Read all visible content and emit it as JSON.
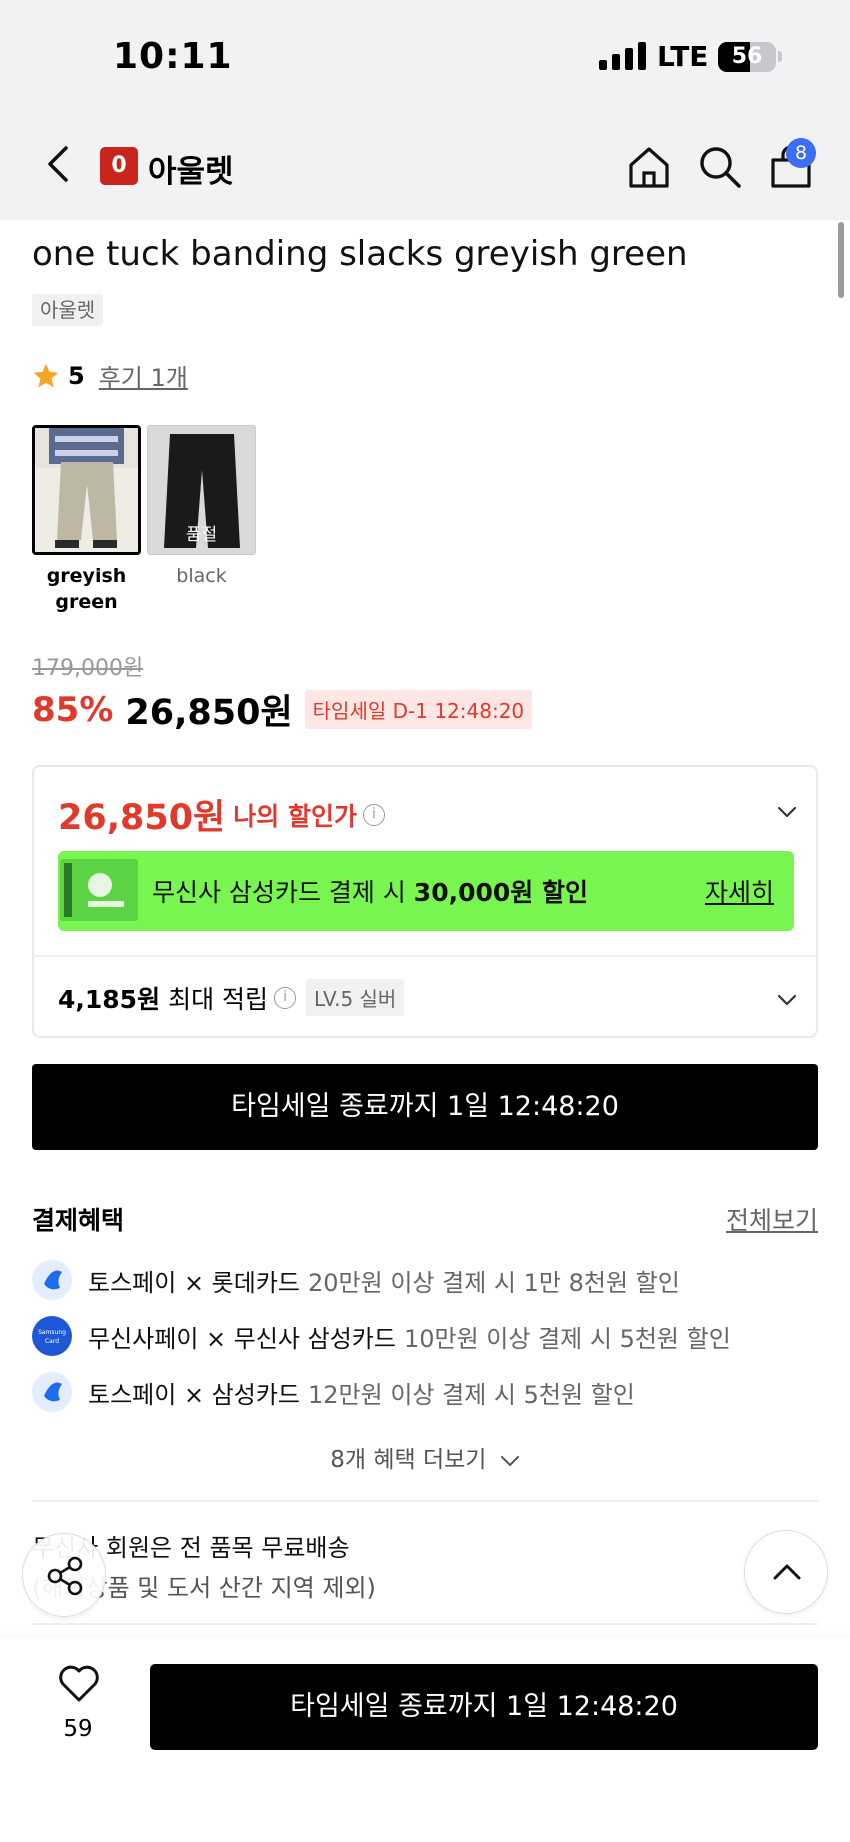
{
  "status_bar": {
    "time": "10:11",
    "network": "LTE",
    "battery": "56",
    "battery_fraction": 0.56
  },
  "nav": {
    "brand_logo": "0",
    "brand_name": "아울렛",
    "cart_count": "8"
  },
  "product": {
    "title": "one tuck banding slacks greyish green",
    "brand_chip": "아울렛",
    "rating": "5",
    "reviews": "후기 1개",
    "options": [
      {
        "label": "greyish\ngreen",
        "selected": true
      },
      {
        "label": "black",
        "selected": false,
        "sold_out": "품절"
      }
    ],
    "original_price": "179,000원",
    "discount": "85%",
    "sale_price": "26,850원",
    "timesale_badge": "타임세일 D-1 12:48:20"
  },
  "benefit_box": {
    "my_price": "26,850원",
    "my_price_label": "나의 할인가",
    "card_text_prefix": "무신사 삼성카드 결제 시 ",
    "card_text_amount": "30,000원 할인",
    "card_more": "자세히",
    "points": "4,185원",
    "points_label": "최대 적립",
    "level": "LV.5 실버"
  },
  "timesale_button": "타임세일 종료까지 1일 12:48:20",
  "payment_benefits": {
    "title": "결제혜택",
    "view_all": "전체보기",
    "items": [
      {
        "name": "토스페이 × 롯데카드",
        "desc": "20만원 이상 결제 시 1만 8천원 할인",
        "icon": "toss-icon"
      },
      {
        "name": "무신사페이 × 무신사 삼성카드",
        "desc": "10만원 이상 결제 시 5천원 할인",
        "icon": "samsung-card-icon",
        "icon_text": "Samsung Card"
      },
      {
        "name": "토스페이 × 삼성카드",
        "desc": "12만원 이상 결제 시 5천원 할인",
        "icon": "toss-icon"
      }
    ],
    "more": "8개 혜택 더보기"
  },
  "shipping": {
    "line1": "무신사 회원은 전 품목 무료배송",
    "line2": "(해외상품 및 도서 산간 지역 제외)"
  },
  "bottom_bar": {
    "likes": "59",
    "buy_button": "타임세일 종료까지 1일 12:48:20"
  },
  "colors": {
    "accent_red": "#e03a2d",
    "card_green": "#79f551",
    "badge_blue": "#3b6ef5",
    "star": "#f5a623"
  }
}
